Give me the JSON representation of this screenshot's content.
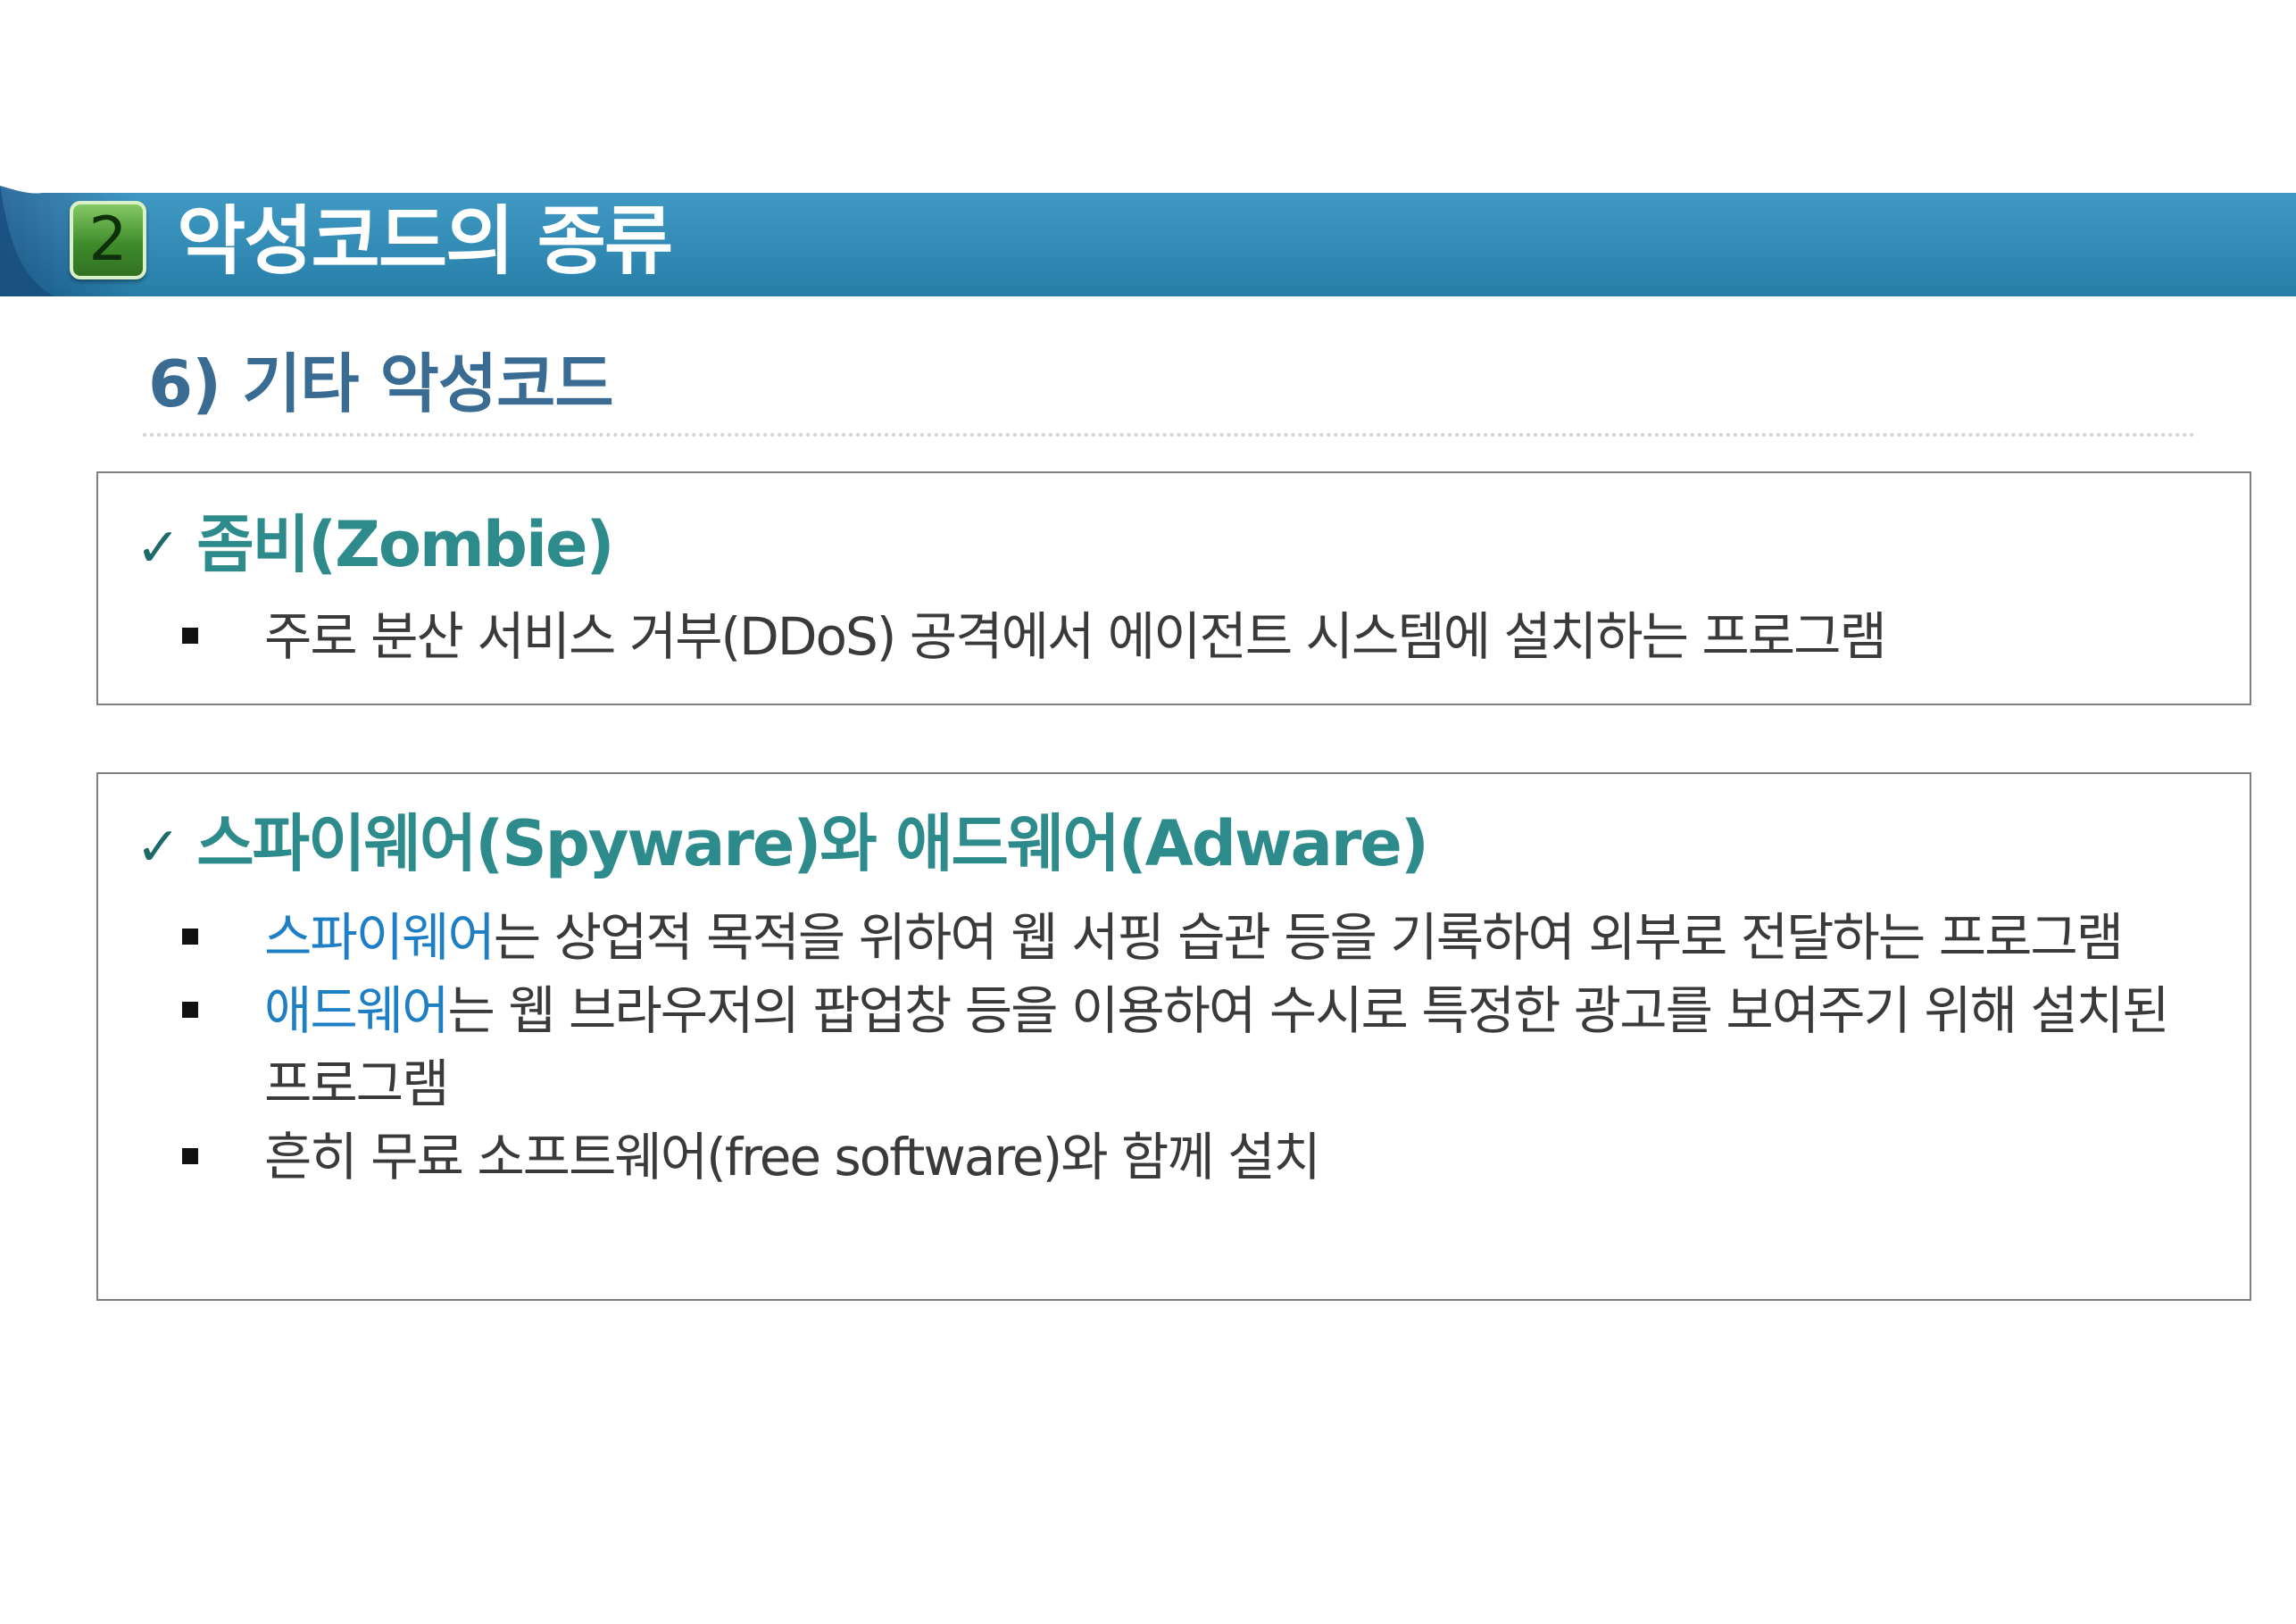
{
  "section": {
    "number": "2",
    "title": "악성코드의 종류"
  },
  "subheading": "6) 기타 악성코드",
  "zombie": {
    "check": "✓",
    "heading": "좀비(Zombie)",
    "bullets": [
      "주로 분산 서비스 거부(DDoS) 공격에서 에이전트 시스템에 설치하는 프로그램"
    ]
  },
  "spyware": {
    "check": "✓",
    "heading": "스파이웨어(Spyware)와 애드웨어(Adware)",
    "bullets": [
      {
        "highlight": "스파이웨어",
        "text": "는 상업적 목적을 위하여 웹 서핑 습관 등을 기록하여 외부로 전달하는 프로그램"
      },
      {
        "highlight": "애드웨어",
        "text": "는 웹 브라우저의 팝업창 등을 이용하여 수시로 특정한 광고를 보여주기 위해 설치된 프로그램"
      },
      {
        "highlight": "",
        "text": "흔히 무료 소프트웨어(free software)와 함께 설치"
      }
    ]
  },
  "colors": {
    "title_bar": "#2b8fbe",
    "title_bar_dark": "#1c5f95",
    "heading_teal": "#2e8b8b",
    "subheading_blue": "#3a6c93",
    "highlight_blue": "#1f7fc4",
    "badge_green": "#3f8c2c"
  }
}
